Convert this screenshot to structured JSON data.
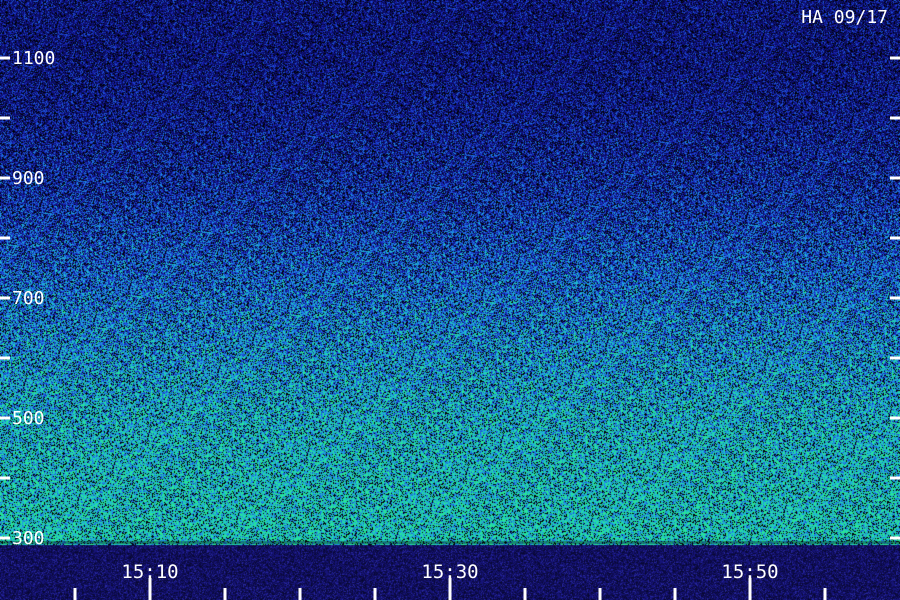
{
  "chart_data": {
    "type": "heatmap",
    "title": "HA 09/17",
    "xlabel": "",
    "ylabel": "",
    "y_ticks": [
      300,
      500,
      700,
      900,
      1100
    ],
    "y_minor_ticks": [
      400,
      600,
      800,
      1000
    ],
    "ylim": [
      300,
      1100
    ],
    "x_ticks": [
      "15:10",
      "15:30",
      "15:50"
    ],
    "x_minor_ticks": [
      "15:05",
      "15:15",
      "15:20",
      "15:25",
      "15:35",
      "15:40",
      "15:45",
      "15:55"
    ],
    "xlim": [
      "15:05",
      "15:55"
    ],
    "grid": false,
    "intensity_profile": {
      "frequency": [
        300,
        500,
        700,
        900,
        1100
      ],
      "relative_intensity": [
        0.85,
        0.75,
        0.55,
        0.3,
        0.15
      ]
    },
    "colors": {
      "background": "#000000",
      "low": "#12138c",
      "mid": "#1f6fe0",
      "high": "#22e0a8",
      "axis_text": "#ffffff",
      "time_band": "#14126a"
    }
  }
}
